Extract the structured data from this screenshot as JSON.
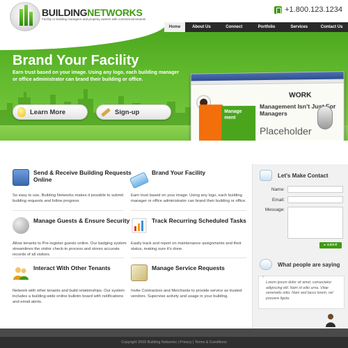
{
  "brand": {
    "name_part1": "BUILDING",
    "name_part2": "NETWORKS",
    "tagline": "Facility or building managers and property owners with commercial tenants"
  },
  "phone": "+1.800.123.1234",
  "nav": [
    "Home",
    "About Us",
    "Connect",
    "Portfolio",
    "Services",
    "Contact Us"
  ],
  "hero": {
    "title": "Brand Your Facility",
    "text": "Earn trust based on your image. Using any logo, each building manager or office administrator can brand their building or office.",
    "learn_more": "Learn More",
    "signup": "Sign-up"
  },
  "preview": {
    "panel_text": "Manage ment",
    "headline": "Management Isn't Just For Managers",
    "placeholder": "Placeholder",
    "work": "WORK"
  },
  "features": [
    {
      "title": "Send & Receive Building Requests Online",
      "text": "So easy to use, Building Networks makes it possible to submit building requests and follow progress",
      "icon": "address-book-icon",
      "color": "#4a7ec9"
    },
    {
      "title": "Brand Your Facility",
      "text": "Earn trust based on your image. Using any logo, each building manager or office administrator can brand their building or office.",
      "icon": "tag-icon",
      "color": "#5aa9e0"
    },
    {
      "title": "Manage Guests & Ensure Security",
      "text": "Allow tenants to Pre-register guests online. Our badging system streamlines the visitor check-in process and stores accurate records of all visitors.",
      "icon": "key-icon",
      "color": "#a0a0a0"
    },
    {
      "title": "Track Recurring Scheduled Tasks",
      "text": "Easily track and report on maintenance assignments and their status, making sure it's done.",
      "icon": "bar-chart-icon",
      "color": "#e26a2c"
    },
    {
      "title": "Interact With Other Tenants",
      "text": "Network with other tenants and build relationships. Our system includes a building-wide online bulletin board with notifications and email alerts.",
      "icon": "people-icon",
      "color": "#e8a322"
    },
    {
      "title": "Manage Service Requests",
      "text": "Invite Contractors and Merchants to provide service as trusted vendors. Supervise activity and usage in your building.",
      "icon": "notepad-icon",
      "color": "#c9b779"
    }
  ],
  "contact": {
    "title": "Let's Make Contact",
    "name_label": "Name:",
    "email_label": "Email:",
    "message_label": "Message:",
    "submit": "▸ submit"
  },
  "testimonials": {
    "title": "What people are saying",
    "quote": "Lorem ipsum dolor sit amet, consectetur adipiscing elit. Nam id odio urna. Vitae venenatis odio. Nam sed lacus lorem, vel posuere ligula."
  },
  "footer": "Copyright 2009 Building Networks  |  Privacy  |  Terms & Conditions"
}
